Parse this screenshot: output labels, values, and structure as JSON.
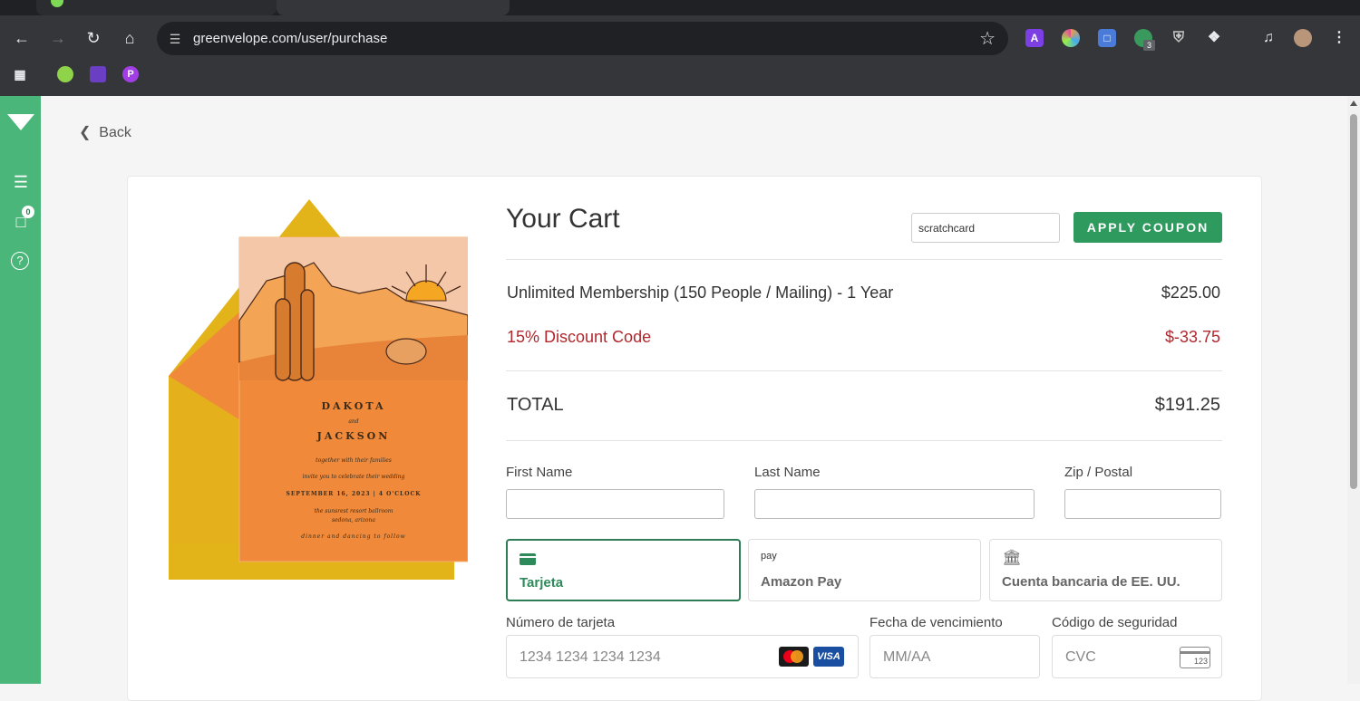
{
  "browser": {
    "url": "greenvelope.com/user/purchase",
    "extension_badge": "3"
  },
  "sidebar": {
    "message_count": "0"
  },
  "page": {
    "back_label": "Back",
    "title": "Your Cart",
    "coupon": {
      "value": "scratchcard",
      "button_label": "APPLY COUPON"
    },
    "lines": [
      {
        "label": "Unlimited Membership (150 People / Mailing) - 1 Year",
        "amount": "$225.00"
      },
      {
        "label": "15% Discount Code",
        "amount": "$-33.75"
      }
    ],
    "total": {
      "label": "TOTAL",
      "amount": "$191.25"
    },
    "fields": {
      "first_name": "First Name",
      "last_name": "Last Name",
      "zip": "Zip / Postal"
    },
    "payment_tabs": [
      {
        "label": "Tarjeta",
        "icon": "credit-card-icon",
        "active": true
      },
      {
        "label": "Amazon Pay",
        "icon": "amazon-pay-icon",
        "active": false
      },
      {
        "label": "Cuenta bancaria de EE. UU.",
        "icon": "bank-icon",
        "active": false
      }
    ],
    "card_fields": {
      "number_label": "Número de tarjeta",
      "number_placeholder": "1234 1234 1234 1234",
      "expiry_label": "Fecha de vencimiento",
      "expiry_placeholder": "MM/AA",
      "cvc_label": "Código de seguridad",
      "cvc_placeholder": "CVC",
      "cvc_icon_text": "123",
      "visa_text": "VISA"
    },
    "invitation": {
      "name1": "DAKOTA",
      "and": "and",
      "name2": "JACKSON",
      "line1": "together with their families",
      "line2": "invite you to celebrate their wedding",
      "date": "SEPTEMBER 16, 2023 | 4 O'CLOCK",
      "venue1": "the sunsrest resort ballroom",
      "venue2": "sedona, arizona",
      "footer": "dinner and dancing to follow"
    }
  },
  "colors": {
    "brand_green": "#4bb67a",
    "button_green": "#2e9a5e",
    "discount_red": "#b0282e"
  }
}
